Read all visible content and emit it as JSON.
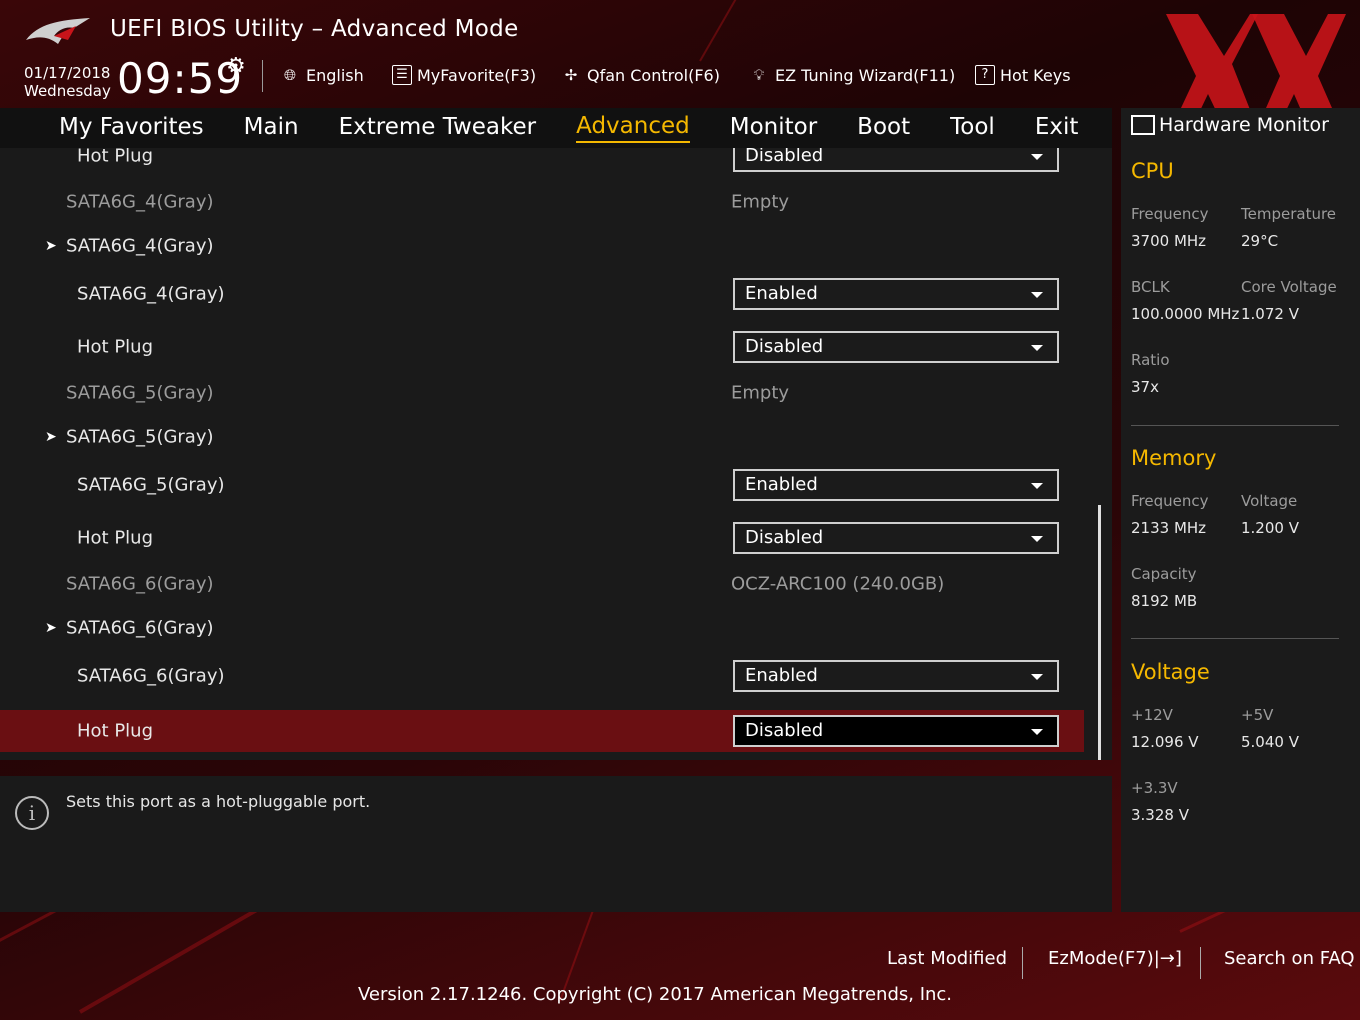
{
  "header": {
    "title": "UEFI BIOS Utility – Advanced Mode",
    "date": "01/17/2018",
    "weekday": "Wednesday",
    "time": "09:59",
    "toolbar": {
      "language": "English",
      "favorite": "MyFavorite(F3)",
      "qfan": "Qfan Control(F6)",
      "ez_tuning": "EZ Tuning Wizard(F11)",
      "hot_keys": "Hot Keys"
    }
  },
  "nav": {
    "tabs": [
      "My Favorites",
      "Main",
      "Extreme Tweaker",
      "Advanced",
      "Monitor",
      "Boot",
      "Tool",
      "Exit"
    ],
    "active": "Advanced"
  },
  "main": {
    "top_partial": {
      "label": "Hot Plug",
      "value": "Disabled"
    },
    "rows": [
      {
        "label": "SATA6G_4(Gray)",
        "value": "Empty"
      },
      {
        "label": "SATA6G_4(Gray)"
      },
      {
        "label": "SATA6G_4(Gray)",
        "value": "Enabled"
      },
      {
        "label": "Hot Plug",
        "value": "Disabled"
      },
      {
        "label": "SATA6G_5(Gray)",
        "value": "Empty"
      },
      {
        "label": "SATA6G_5(Gray)"
      },
      {
        "label": "SATA6G_5(Gray)",
        "value": "Enabled"
      },
      {
        "label": "Hot Plug",
        "value": "Disabled"
      },
      {
        "label": "SATA6G_6(Gray)",
        "value": "OCZ-ARC100 (240.0GB)"
      },
      {
        "label": "SATA6G_6(Gray)"
      },
      {
        "label": "SATA6G_6(Gray)",
        "value": "Enabled"
      },
      {
        "label": "Hot Plug",
        "value": "Disabled"
      }
    ],
    "arrow_glyph": "➤",
    "caret_glyph": "▼"
  },
  "help": {
    "text": "Sets this port as a hot-pluggable port.",
    "icon": "info-icon"
  },
  "hw_monitor": {
    "title": "Hardware Monitor",
    "cpu": {
      "heading": "CPU",
      "frequency_label": "Frequency",
      "frequency": "3700 MHz",
      "temperature_label": "Temperature",
      "temperature": "29°C",
      "bclk_label": "BCLK",
      "bclk": "100.0000 MHz",
      "core_voltage_label": "Core Voltage",
      "core_voltage": "1.072 V",
      "ratio_label": "Ratio",
      "ratio": "37x"
    },
    "memory": {
      "heading": "Memory",
      "frequency_label": "Frequency",
      "frequency": "2133 MHz",
      "voltage_label": "Voltage",
      "voltage": "1.200 V",
      "capacity_label": "Capacity",
      "capacity": "8192 MB"
    },
    "voltage": {
      "heading": "Voltage",
      "v12_label": "+12V",
      "v12": "12.096 V",
      "v5_label": "+5V",
      "v5": "5.040 V",
      "v33_label": "+3.3V",
      "v33": "3.328 V"
    }
  },
  "footer": {
    "last_modified": "Last Modified",
    "ezmode": "EzMode(F7)|→]",
    "search": "Search on FAQ",
    "version": "Version 2.17.1246. Copyright (C) 2017 American Megatrends, Inc."
  },
  "colors": {
    "accent": "#f5b800",
    "selected_row": "#6a0f12",
    "brand_red": "#c8141a"
  }
}
